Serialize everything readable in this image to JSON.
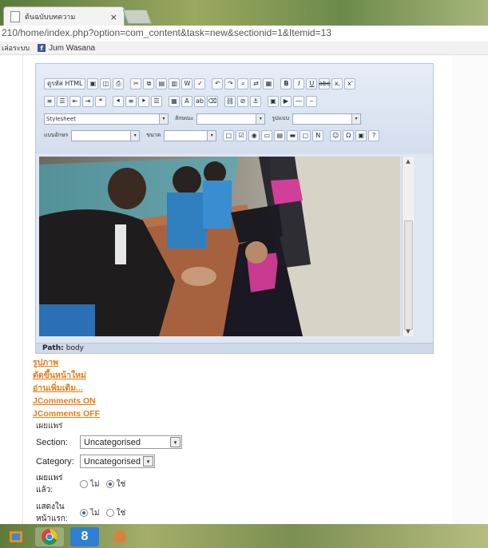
{
  "browser": {
    "tab_title": "ต้นฉบับบทความ",
    "tab_close": "×",
    "url": "210/home/index.php?option=com_content&task=new&sectionid=1&Itemid=13",
    "bookmarks": [
      {
        "label": "เล่อระบบ"
      },
      {
        "icon": "f",
        "label": "Jum Wasana"
      }
    ]
  },
  "editor": {
    "toolbar": {
      "source_label": "ดูรหัส HTML",
      "bold": "B",
      "italic": "I",
      "underline": "U",
      "strike": "abc",
      "subscript": "x,",
      "superscript": "x'",
      "styles_label": "Stylesheet",
      "format_label": "ลักษณะ",
      "font_label": "รูปแบบ",
      "fontfamily_label": "แบบอักษร",
      "size_label": "ขนาด"
    },
    "path_label": "Path:",
    "path_value": "body"
  },
  "links": [
    "รูปภาพ",
    "ตัดขึ้นหน้าใหม่",
    "อ่านเพิ่มเติม...",
    "JComments ON",
    "JComments OFF"
  ],
  "form": {
    "publish_heading": "เผยแพร่",
    "section_label": "Section:",
    "section_value": "Uncategorised",
    "category_label": "Category:",
    "category_value": "Uncategorised",
    "published_label_1": "เผยแพร่",
    "published_label_2": "แล้ว:",
    "frontpage_label_1": "แสดงใน",
    "frontpage_label_2": "หน้าแรก:",
    "no_label": "ไม่",
    "yes_label": "ใช่",
    "published_value": "yes",
    "frontpage_value": "no"
  },
  "taskbar": {
    "items": [
      "windows-explorer-icon",
      "chrome-icon",
      "google-icon",
      "app-icon"
    ]
  }
}
